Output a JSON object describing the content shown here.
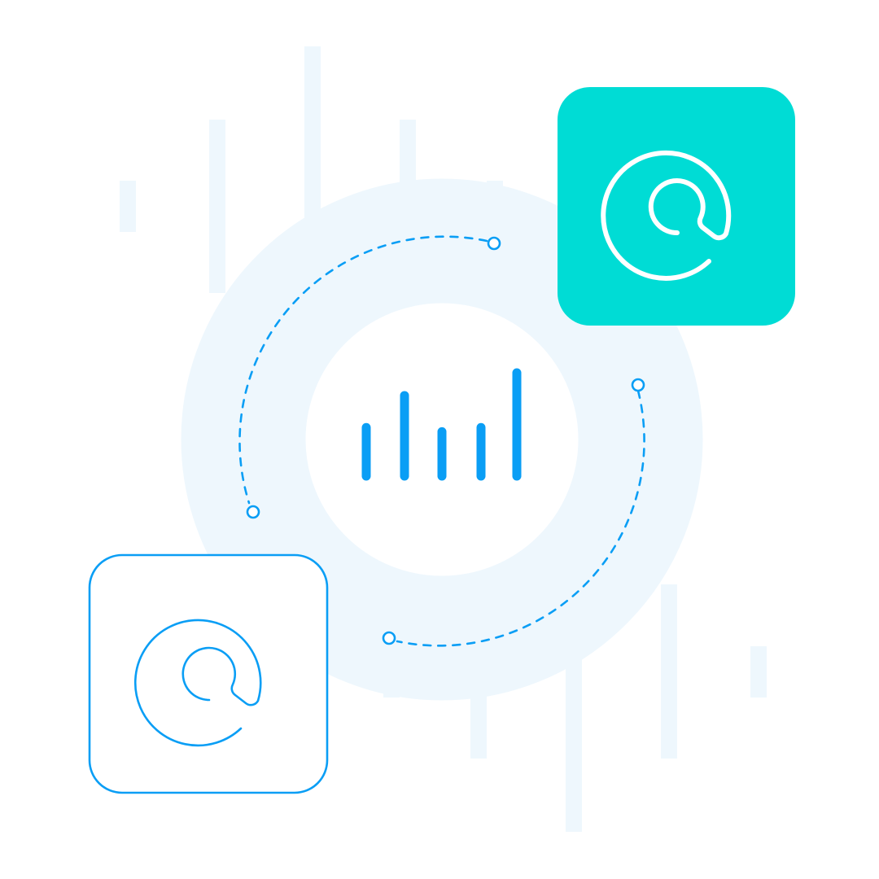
{
  "colors": {
    "background": "#ffffff",
    "pale_blue": "#eef7fd",
    "accent_blue": "#0a9ef5",
    "teal": "#00dcd5",
    "white": "#ffffff"
  },
  "icons": {
    "center": "bar-chart-icon",
    "top_right_card": "at-sign-icon",
    "bottom_left_card": "at-sign-icon",
    "connector": "dashed-cycle-arrows"
  },
  "bar_levels": [
    0.47,
    0.78,
    0.43,
    0.47,
    1.0
  ]
}
